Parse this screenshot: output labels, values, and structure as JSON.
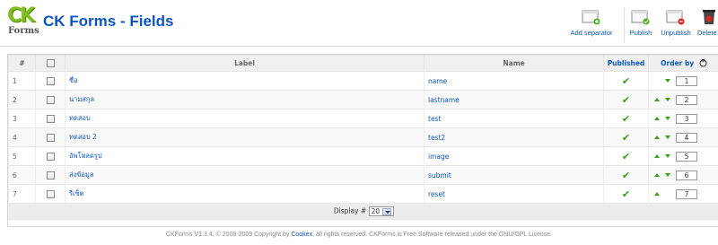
{
  "header": {
    "logo_top": "CK",
    "logo_bottom": "Forms",
    "title": "CK Forms - Fields"
  },
  "toolbar": {
    "add_separator": "Add separator",
    "publish": "Publish",
    "unpublish": "Unpublish",
    "delete": "Delete"
  },
  "table": {
    "headers": {
      "num": "#",
      "label": "Label",
      "name": "Name",
      "published": "Published",
      "order_by": "Order by"
    },
    "rows": [
      {
        "num": "1",
        "label": "ชื่อ",
        "name": "name",
        "order": "1"
      },
      {
        "num": "2",
        "label": "นามสกุล",
        "name": "lastname",
        "order": "2"
      },
      {
        "num": "3",
        "label": "ทดสอบ",
        "name": "test",
        "order": "3"
      },
      {
        "num": "4",
        "label": "ทดสอบ 2",
        "name": "test2",
        "order": "4"
      },
      {
        "num": "5",
        "label": "อัพโหลดรูป",
        "name": "image",
        "order": "5"
      },
      {
        "num": "6",
        "label": "ส่งข้อมูล",
        "name": "submit",
        "order": "6"
      },
      {
        "num": "7",
        "label": "รีเซ็ต",
        "name": "reset",
        "order": "7"
      }
    ],
    "display_label": "Display #",
    "display_value": "20"
  },
  "footer": {
    "copyright_pre": "CKForms V1.3.4, © 2008-2009 Copyright by",
    "copyright_link": "Cookex",
    "copyright_post": ", all rights reserved. CKForms is Free Software released under the GNU/GPL License."
  },
  "colors": {
    "brand_blue": "#0b55c4",
    "accent_green": "#3a9d1a"
  }
}
